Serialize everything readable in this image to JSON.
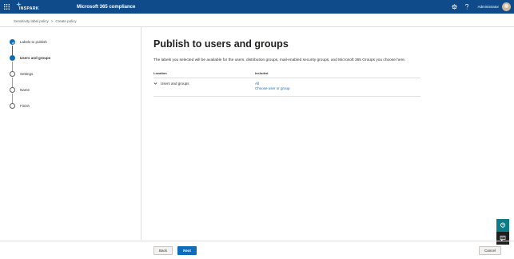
{
  "suite_bar": {
    "brand": "INSPARK",
    "app_title": "Microsoft 365 compliance",
    "user_name": "Administrator",
    "icons": [
      "waffle-icon",
      "gear-icon",
      "help-icon"
    ]
  },
  "breadcrumb": {
    "items": [
      "Sensitivity label policy",
      "Create policy"
    ],
    "separator": ">"
  },
  "steps": [
    {
      "label": "Labels to publish",
      "state": "done"
    },
    {
      "label": "Users and groups",
      "state": "current"
    },
    {
      "label": "Settings",
      "state": "pending"
    },
    {
      "label": "Name",
      "state": "pending"
    },
    {
      "label": "Finish",
      "state": "pending"
    }
  ],
  "main": {
    "title": "Publish to users and groups",
    "description": "The labels you selected will be available for the users, distribution groups, mail-enabled security groups, and Microsoft 365 Groups you choose here.",
    "table": {
      "headers": {
        "location": "Location",
        "included": "Included"
      },
      "rows": [
        {
          "location": "Users and groups",
          "included_value": "All",
          "action_link": "Choose user or group"
        }
      ]
    }
  },
  "footer": {
    "back_label": "Back",
    "next_label": "Next",
    "cancel_label": "Cancel"
  },
  "colors": {
    "suite_bar": "#0f4a8a",
    "accent": "#0f6cbd",
    "help_fab": "#0e7c86",
    "chat_fab": "#1f1f1f"
  }
}
